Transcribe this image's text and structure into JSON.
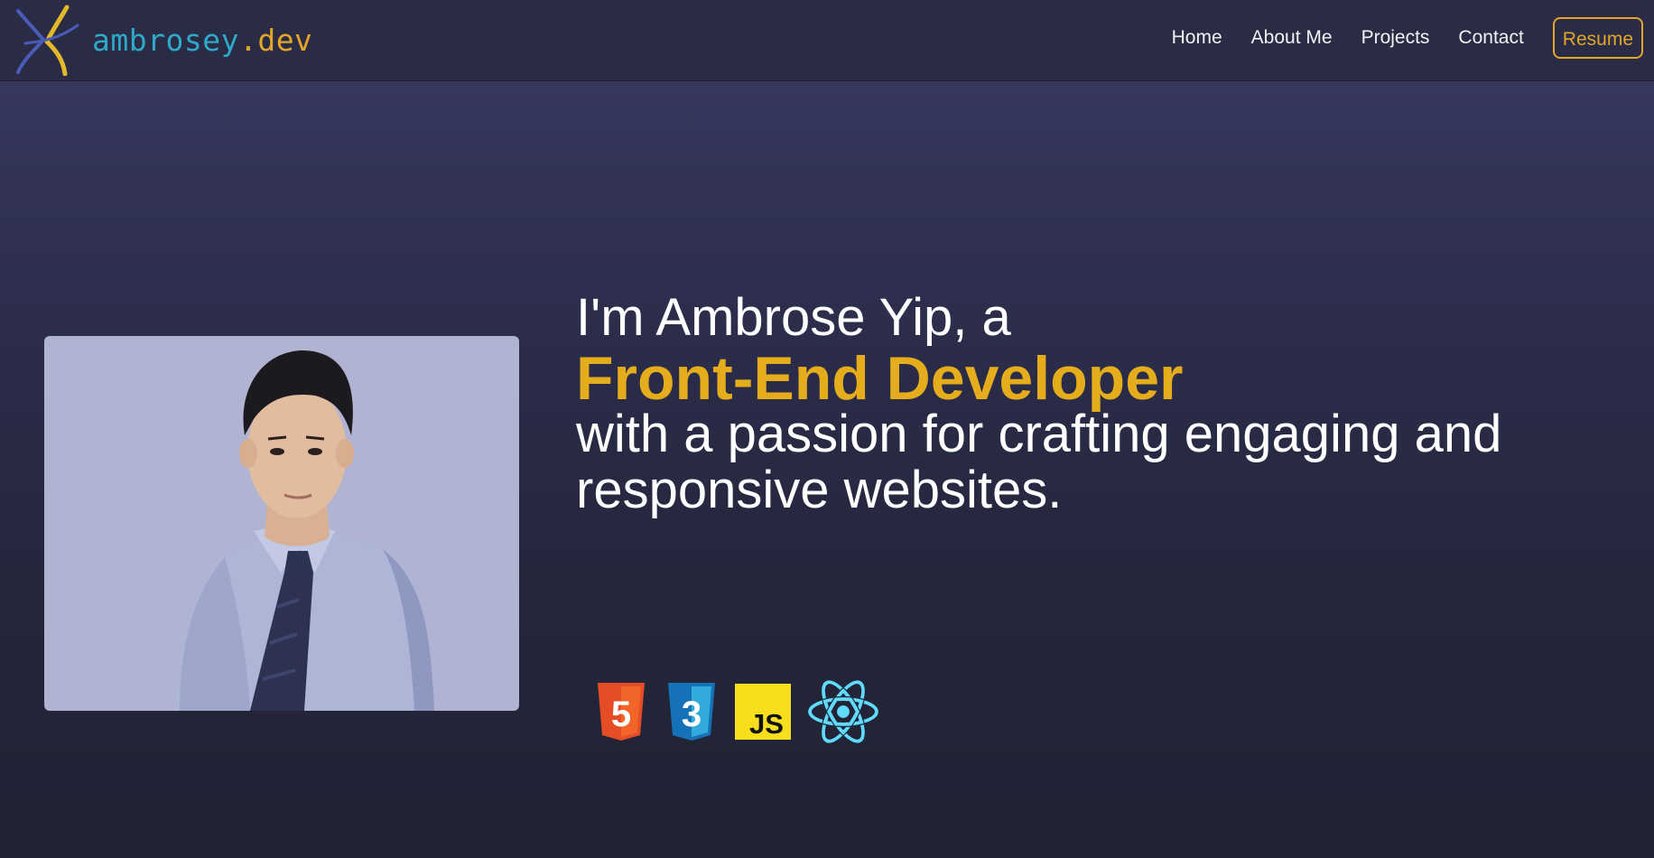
{
  "brand": {
    "name": "ambrosey",
    "tld": ".dev",
    "logo_icon": "ay-monogram-logo"
  },
  "nav": {
    "items": [
      {
        "label": "Home"
      },
      {
        "label": "About Me"
      },
      {
        "label": "Projects"
      },
      {
        "label": "Contact"
      }
    ],
    "resume_label": "Resume"
  },
  "hero": {
    "intro": "I'm Ambrose Yip, a",
    "role": "Front-End Developer",
    "tagline": "with a passion for crafting engaging and responsive websites.",
    "photo_icon": "profile-photo"
  },
  "tech_stack": [
    {
      "name": "HTML5",
      "icon": "html5-icon",
      "label": "5",
      "color": "#e44d26"
    },
    {
      "name": "CSS3",
      "icon": "css3-icon",
      "label": "3",
      "color": "#1572b6"
    },
    {
      "name": "JavaScript",
      "icon": "javascript-icon",
      "label": "JS",
      "color": "#f7df1e"
    },
    {
      "name": "React",
      "icon": "react-icon",
      "color": "#61dafb"
    }
  ],
  "colors": {
    "accent": "#e5ac1c",
    "brand_teal": "#2ea9c9",
    "nav_background": "#2a2b44",
    "photo_background": "#b1b3d3"
  }
}
